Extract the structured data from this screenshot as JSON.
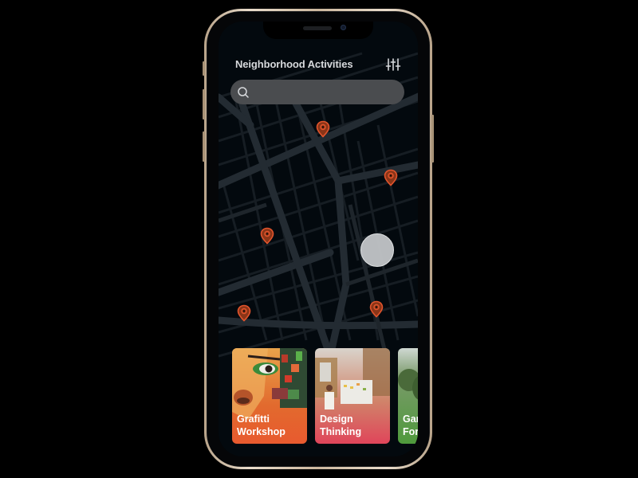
{
  "header": {
    "title": "Neighborhood Activities",
    "filter_icon": "sliders-icon"
  },
  "search": {
    "value": "",
    "placeholder": "",
    "icon": "search-icon"
  },
  "map": {
    "pins": [
      {
        "name": "activity-pin-1",
        "icon": "map-pin-icon"
      },
      {
        "name": "activity-pin-2",
        "icon": "map-pin-icon"
      },
      {
        "name": "activity-pin-3",
        "icon": "map-pin-icon"
      },
      {
        "name": "activity-pin-4",
        "icon": "map-pin-icon"
      },
      {
        "name": "activity-pin-5",
        "icon": "map-pin-icon"
      }
    ],
    "pin_color": "#e2542c",
    "current_location_marker": "user-location-marker"
  },
  "cards": [
    {
      "line1": "Grafitti",
      "line2": "Workshop",
      "color": "#e85a2f"
    },
    {
      "line1": "Design",
      "line2": "Thinking",
      "color": "#e0455a"
    },
    {
      "line1": "Gar",
      "line2": "For",
      "color": "#4f9a3c"
    }
  ],
  "colors": {
    "background": "#03090e",
    "road": "#222a31",
    "search_bg": "#4a4c4f"
  }
}
